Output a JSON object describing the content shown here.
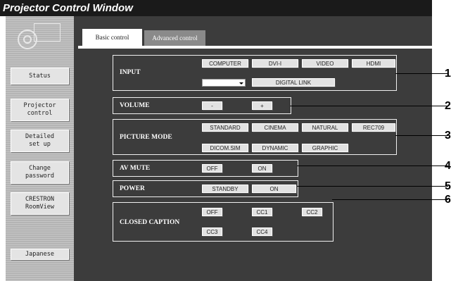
{
  "window_title": "Projector Control Window",
  "sidebar": {
    "buttons": [
      {
        "label": "Status"
      },
      {
        "label": "Projector\ncontrol"
      },
      {
        "label": "Detailed\nset up"
      },
      {
        "label": "Change\npassword"
      },
      {
        "label": "CRESTRON\nRoomView"
      },
      {
        "label": "Japanese"
      }
    ]
  },
  "tabs": {
    "basic": "Basic control",
    "advanced": "Advanced control"
  },
  "groups": {
    "input": {
      "label": "INPUT",
      "buttons": [
        "COMPUTER",
        "DVI-I",
        "VIDEO",
        "HDMI"
      ],
      "select_value": "",
      "digital_link": "DIGITAL LINK"
    },
    "volume": {
      "label": "VOLUME",
      "minus": "-",
      "plus": "+"
    },
    "picture_mode": {
      "label": "PICTURE MODE",
      "row1": [
        "STANDARD",
        "CINEMA",
        "NATURAL",
        "REC709"
      ],
      "row2": [
        "DICOM.SIM",
        "DYNAMIC",
        "GRAPHIC"
      ]
    },
    "av_mute": {
      "label": "AV MUTE",
      "off": "OFF",
      "on": "ON"
    },
    "power": {
      "label": "POWER",
      "standby": "STANDBY",
      "on": "ON"
    },
    "closed_caption": {
      "label": "CLOSED CAPTION",
      "row1": [
        "OFF",
        "CC1",
        "CC2"
      ],
      "row2": [
        "CC3",
        "CC4"
      ]
    }
  },
  "callouts": [
    "1",
    "2",
    "3",
    "4",
    "5",
    "6"
  ]
}
